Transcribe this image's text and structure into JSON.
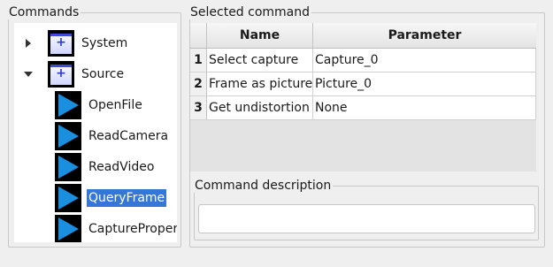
{
  "commands": {
    "title": "Commands",
    "tree": [
      {
        "label": "System",
        "type": "folder",
        "expanded": false
      },
      {
        "label": "Source",
        "type": "folder",
        "expanded": true
      },
      {
        "label": "OpenFile",
        "type": "command"
      },
      {
        "label": "ReadCamera",
        "type": "command"
      },
      {
        "label": "ReadVideo",
        "type": "command"
      },
      {
        "label": "QueryFrame",
        "type": "command",
        "selected": true
      },
      {
        "label": "CaptureProperty",
        "type": "command"
      }
    ]
  },
  "selected_command": {
    "title": "Selected command",
    "columns": [
      "Name",
      "Parameter"
    ],
    "rows": [
      {
        "num": "1",
        "name": "Select capture",
        "parameter": "Capture_0"
      },
      {
        "num": "2",
        "name": "Frame as picture",
        "parameter": "Picture_0"
      },
      {
        "num": "3",
        "name": "Get undistortion c",
        "parameter": "None"
      }
    ],
    "description_title": "Command description",
    "description_value": ""
  },
  "icons": {
    "collapsed_arrow": "chevron-right-icon",
    "expanded_arrow": "chevron-down-icon",
    "folder": "folder-plus-icon",
    "command": "play-icon"
  },
  "colors": {
    "selection": "#3477d9",
    "play_icon": "#1a8fe0",
    "folder_accent": "#3c4ed8"
  }
}
